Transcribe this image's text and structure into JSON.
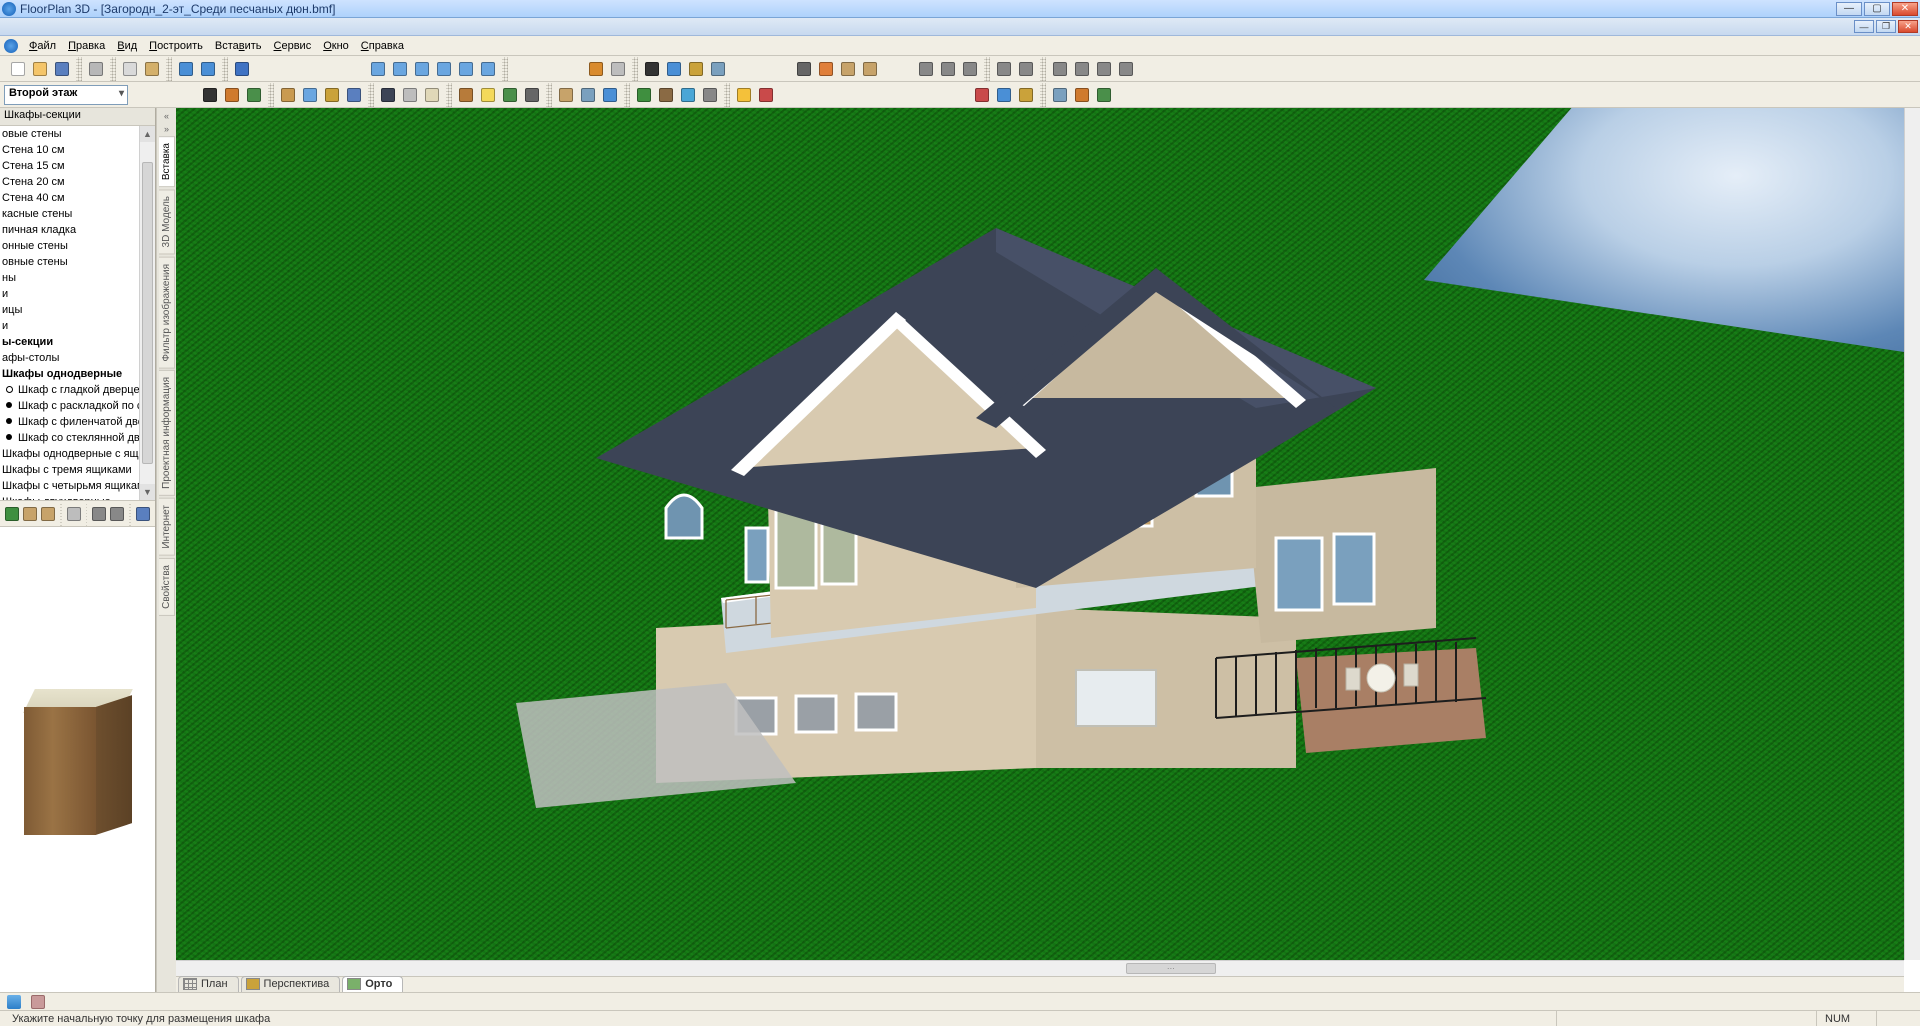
{
  "title": "FloorPlan 3D - [Загородн_2-эт_Среди песчаных дюн.bmf]",
  "menu": {
    "items": [
      "Файл",
      "Правка",
      "Вид",
      "Построить",
      "Вставить",
      "Сервис",
      "Окно",
      "Справка"
    ]
  },
  "floor_selector": {
    "value": "Второй этаж"
  },
  "side_panel": {
    "header": "Шкафы-секции",
    "items": [
      {
        "label": "овые стены"
      },
      {
        "label": "Стена 10 см"
      },
      {
        "label": "Стена 15 см"
      },
      {
        "label": "Стена 20 см"
      },
      {
        "label": "Стена 40 см"
      },
      {
        "label": "касные стены"
      },
      {
        "label": "пичная кладка"
      },
      {
        "label": "онные стены"
      },
      {
        "label": "овные стены"
      },
      {
        "label": "ны"
      },
      {
        "label": "и"
      },
      {
        "label": "ицы"
      },
      {
        "label": "и"
      },
      {
        "label": "ы-секции",
        "bold": true
      },
      {
        "label": "афы-столы"
      },
      {
        "label": "Шкафы однодверные",
        "bold": true
      },
      {
        "label": "Шкаф с гладкой дверцей",
        "sub": true,
        "hollow": true
      },
      {
        "label": "Шкаф с раскладкой по стеклу",
        "sub": true
      },
      {
        "label": "Шкаф с филенчатой дверцей",
        "sub": true
      },
      {
        "label": "Шкаф со стеклянной дверцей",
        "sub": true
      },
      {
        "label": "Шкафы однодверные с ящиком"
      },
      {
        "label": "Шкафы с тремя ящиками"
      },
      {
        "label": "Шкафы с четырьмя ящиками"
      },
      {
        "label": "Шкафы двухдверные"
      }
    ]
  },
  "dock_tabs": [
    "Вставка",
    "3D Модель",
    "Фильтр изображения",
    "Проектная информация",
    "Интернет",
    "Свойства"
  ],
  "view_tabs": {
    "items": [
      {
        "label": "План",
        "icon": "grid"
      },
      {
        "label": "Перспектива",
        "icon": "box"
      },
      {
        "label": "Орто",
        "icon": "ortho",
        "active": true
      }
    ]
  },
  "status": {
    "message": "Укажите начальную точку для размещения шкафа",
    "indicator": "NUM"
  },
  "toolbar1_icons": [
    "new",
    "open",
    "save",
    "sep",
    "print",
    "sep",
    "copy",
    "paste",
    "sep",
    "undo",
    "redo",
    "sep",
    "help"
  ],
  "toolbar1b_icons": [
    "zoom-in",
    "zoom-out",
    "zoom-window",
    "zoom-fit",
    "zoom-prev",
    "pan",
    "sep"
  ],
  "toolbar1c_icons": [
    "render",
    "print-render",
    "sep",
    "text",
    "dim",
    "measure",
    "layers"
  ],
  "toolbar1d_icons": [
    "grid",
    "snap",
    "ruler-v",
    "ruler-h"
  ],
  "toolbar1e_icons": [
    "align-l",
    "align-c",
    "align-r",
    "sep",
    "dist-h",
    "dist-v",
    "sep",
    "send-b",
    "send-f",
    "rot-l",
    "rot-r"
  ],
  "toolbar2_icons": [
    "pointer",
    "wall",
    "room",
    "sep",
    "door",
    "window",
    "stairs",
    "column",
    "sep",
    "roof",
    "slab",
    "ceiling",
    "sep",
    "furniture",
    "light",
    "terrain",
    "camera",
    "sep",
    "path",
    "region",
    "fill",
    "sep",
    "plant",
    "fence",
    "pool",
    "road",
    "sep",
    "sun",
    "car"
  ],
  "toolbar2b_icons": [
    "roof1",
    "roof2",
    "roof3",
    "sep",
    "roof4",
    "roof5",
    "roof6"
  ],
  "mini_tools": [
    "play",
    "box",
    "box2",
    "sep",
    "copy-item",
    "sep",
    "tree1",
    "tree2",
    "sep",
    "list-icon"
  ],
  "colors": {
    "roof": "#3c4456",
    "siding": "#d8cab0",
    "trim": "#ffffff",
    "terrace": "#cfd8df",
    "brick": "#a97f65",
    "railing": "#1d1d1d"
  }
}
